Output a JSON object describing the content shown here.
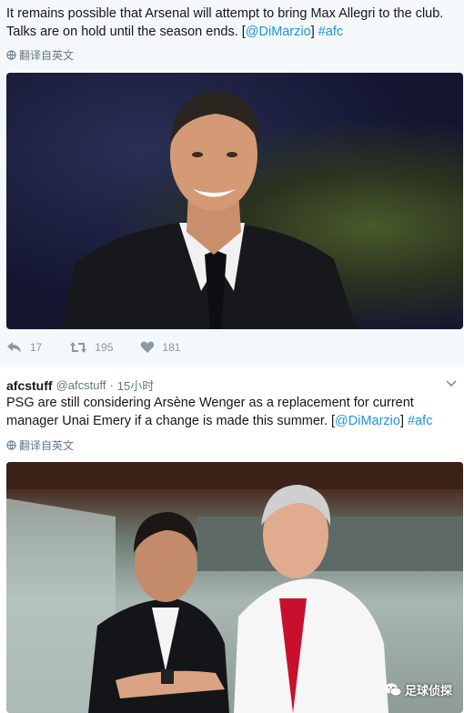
{
  "tweet1": {
    "text_part1": "It remains possible that Arsenal will attempt to bring Max Allegri to the club. Talks are on hold until the season ends. [",
    "mention": "@DiMarzio",
    "text_part2": "] ",
    "hashtag": "#afc",
    "translate_label": "翻译自英文",
    "reply_count": "17",
    "retweet_count": "195",
    "like_count": "181"
  },
  "tweet2": {
    "display_name": "afcstuff",
    "handle": "@afcstuff",
    "separator": "·",
    "time": "15小时",
    "text_part1": "PSG are still considering Arsène Wenger as a replacement for current manager Unai Emery if a change is made this summer. [",
    "mention": "@DiMarzio",
    "text_part2": "] ",
    "hashtag": "#afc",
    "translate_label": "翻译自英文"
  },
  "watermark": {
    "label": "足球侦探",
    "icon": "wechat-icon"
  },
  "colors": {
    "link": "#1b95e0",
    "muted": "#657786",
    "action": "#8899a6",
    "tweet1_bg": "#f5f8fa"
  }
}
